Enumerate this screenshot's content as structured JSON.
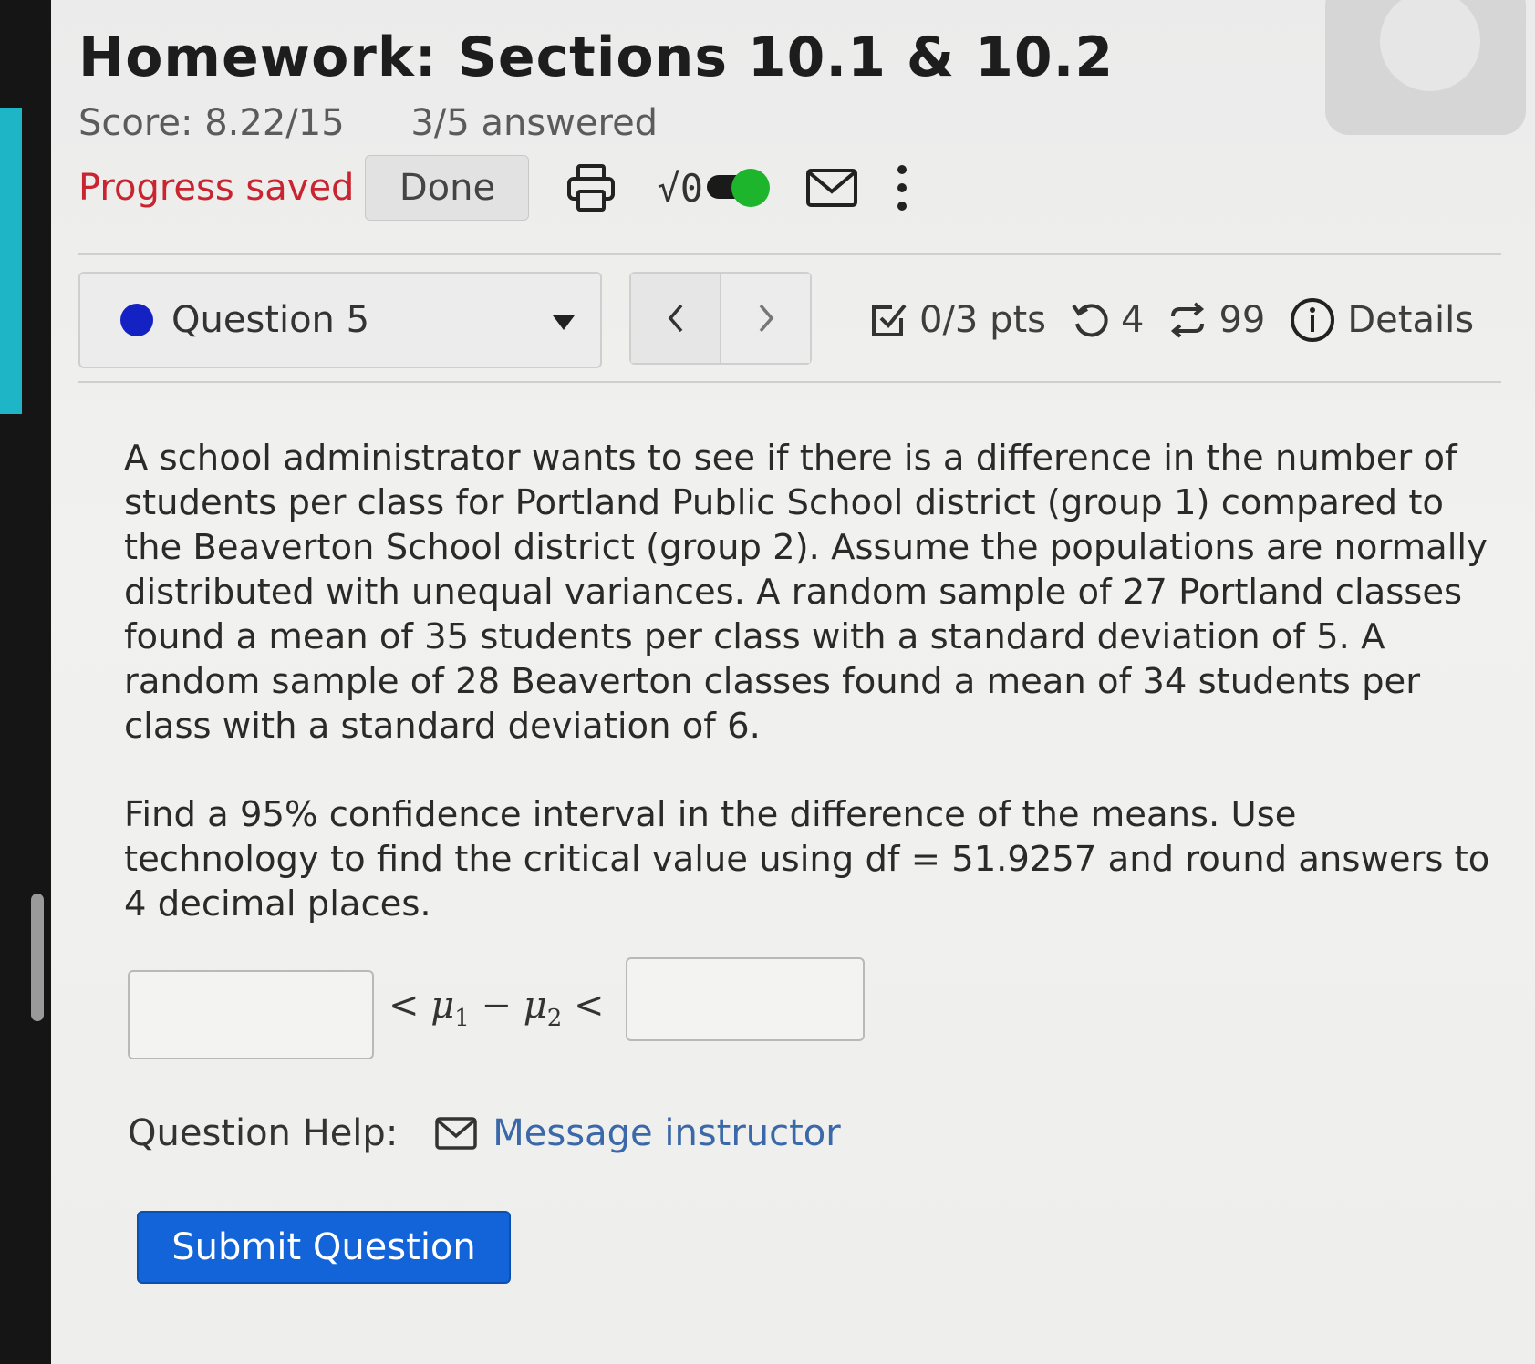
{
  "header": {
    "title": "Homework: Sections 10.1 & 10.2",
    "score": "Score: 8.22/15",
    "answered": "3/5 answered"
  },
  "toolbar": {
    "progress_status": "Progress saved",
    "done_label": "Done",
    "math_toggle_label": "√0",
    "icons": [
      "printer-icon",
      "sqrt-icon",
      "toggle-switch",
      "mail-icon",
      "more-vert-icon"
    ],
    "toggle_color": "#1db52b"
  },
  "question_nav": {
    "selected_question": "Question 5",
    "status_dot_color": "#1422c4",
    "prev_label": "<",
    "next_label": ">",
    "points": "0/3 pts",
    "retries": "4",
    "attempts": "99",
    "details_label": "Details"
  },
  "question": {
    "paragraph1": "A school administrator wants to see if there is a difference in the number of students per class for Portland Public School district (group 1) compared to the Beaverton School district (group 2). Assume the populations are normally distributed with unequal variances. A random sample of 27 Portland classes found a mean of 35 students per class with a standard deviation of 5. A random sample of 28 Beaverton classes found a mean of 34 students per class with a standard deviation of 6.",
    "paragraph2": "Find a 95% confidence interval in the difference of the means. Use technology to find the critical value using df = 51.9257 and round answers to 4 decimal places.",
    "lower_bound_value": "",
    "upper_bound_value": "",
    "inequality": {
      "lt": "<",
      "mu": "μ",
      "sub1": "1",
      "minus": "−",
      "sub2": "2"
    }
  },
  "help": {
    "label": "Question Help:",
    "message_instructor": "Message instructor"
  },
  "submit_label": "Submit Question"
}
